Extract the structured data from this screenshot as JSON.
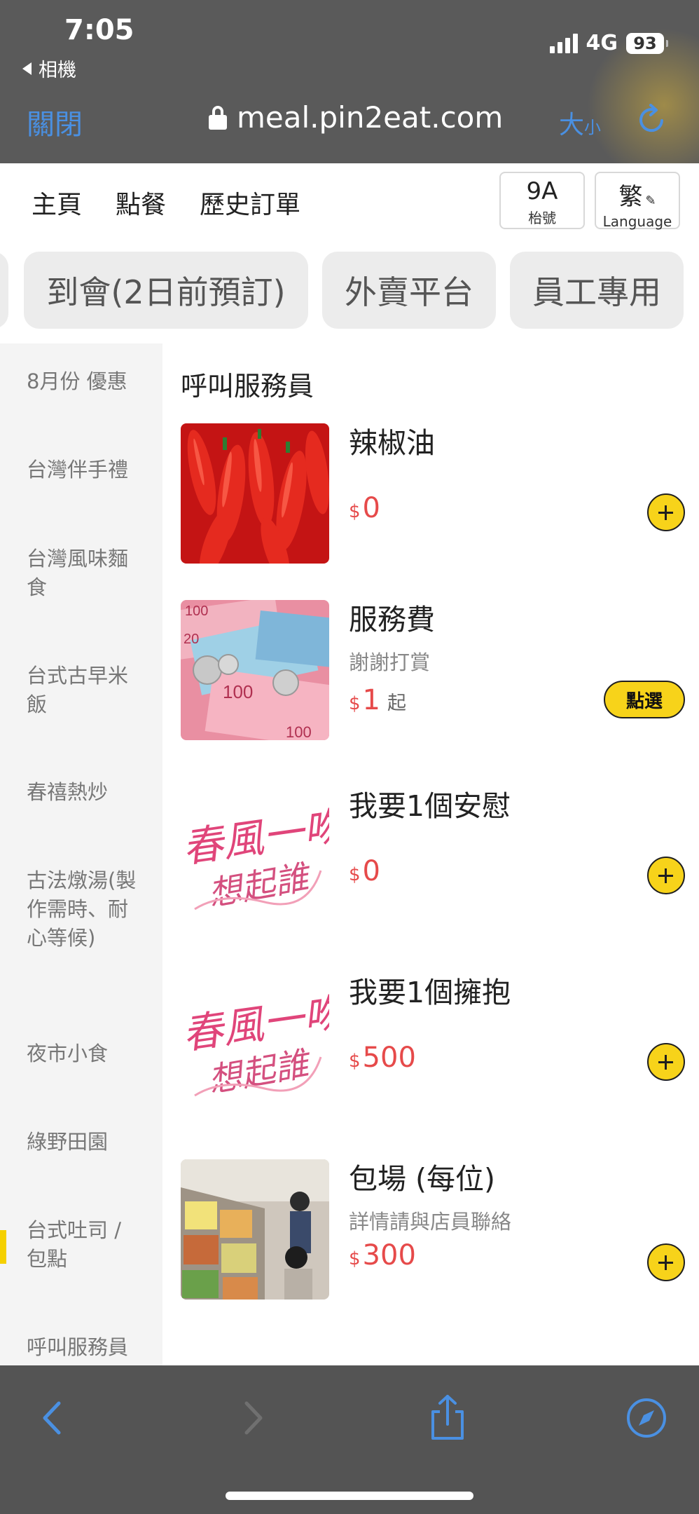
{
  "status_bar": {
    "time": "7:05",
    "back_app": "相機",
    "network": "4G",
    "battery": "93"
  },
  "browser": {
    "close_label": "關閉",
    "url": "meal.pin2eat.com",
    "text_size_big": "大",
    "text_size_small": "小"
  },
  "nav": {
    "tabs": [
      "主頁",
      "點餐",
      "歷史訂單"
    ],
    "active_tab": "點餐",
    "table_no": "9A",
    "table_label": "枱號",
    "lang_char": "繁",
    "lang_label": "Language"
  },
  "category_pills": [
    "到會(2日前預訂)",
    "外賣平台",
    "員工專用"
  ],
  "sidebar": {
    "items": [
      "8月份 優惠",
      "台灣伴手禮",
      "台灣風味麵食",
      "台式古早米飯",
      "春禧熱炒",
      "古法燉湯(製作需時、耐心等候)",
      "夜市小食",
      "綠野田園",
      "台式吐司 / 包點",
      "呼叫服務員"
    ],
    "active_item": "台式吐司 / 包點"
  },
  "menu": {
    "section_title": "呼叫服務員",
    "currency": "$",
    "items": [
      {
        "name": "辣椒油",
        "desc": "",
        "price": "0",
        "from": "",
        "action": "add"
      },
      {
        "name": "服務費",
        "desc": "謝謝打賞",
        "price": "1",
        "from": "起",
        "action": "choose",
        "choose_label": "點選"
      },
      {
        "name": "我要1個安慰",
        "desc": "",
        "price": "0",
        "from": "",
        "action": "add",
        "image_text_1": "春風一吻",
        "image_text_2": "想起誰"
      },
      {
        "name": "我要1個擁抱",
        "desc": "",
        "price": "500",
        "from": "",
        "action": "add",
        "image_text_1": "春風一吻",
        "image_text_2": "想起誰"
      },
      {
        "name": "包場 (每位)",
        "desc": "詳情請與店員聯絡",
        "price": "300",
        "from": "",
        "action": "add"
      }
    ]
  },
  "colors": {
    "accent_yellow": "#f7d31a",
    "price_red": "#e64a4a",
    "browser_blue": "#4a90e2"
  },
  "toolbar_icons": [
    "back-arrow-icon",
    "forward-arrow-icon",
    "share-icon",
    "compass-icon"
  ]
}
